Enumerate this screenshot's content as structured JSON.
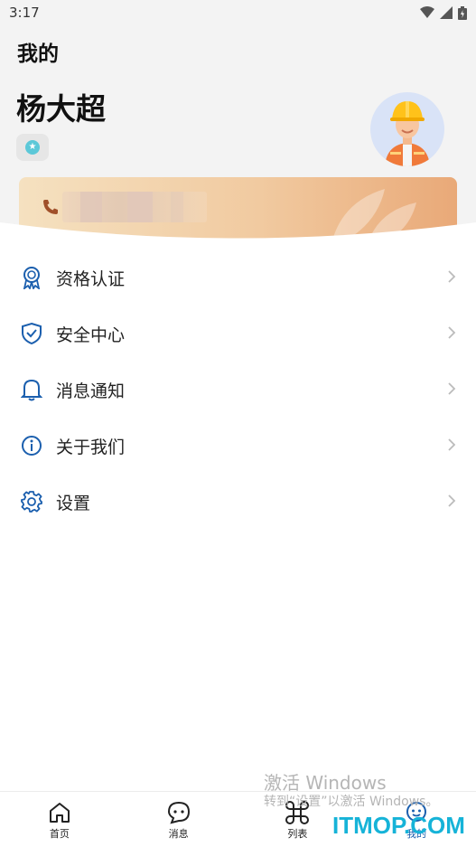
{
  "status_bar": {
    "time": "3:17"
  },
  "header": {
    "title": "我的"
  },
  "profile": {
    "name": "杨大超",
    "badge_icon": "star-badge-icon",
    "phone_icon": "phone-icon"
  },
  "menu": {
    "items": [
      {
        "label": "资格认证",
        "icon": "certificate-icon"
      },
      {
        "label": "安全中心",
        "icon": "shield-icon"
      },
      {
        "label": "消息通知",
        "icon": "bell-icon"
      },
      {
        "label": "关于我们",
        "icon": "info-icon"
      },
      {
        "label": "设置",
        "icon": "gear-icon"
      }
    ]
  },
  "watermark": {
    "line1": "激活 Windows",
    "line2": "转到“设置”以激活 Windows。"
  },
  "tabs": [
    {
      "label": "首页",
      "icon": "home-icon",
      "active": false
    },
    {
      "label": "消息",
      "icon": "chat-icon",
      "active": false
    },
    {
      "label": "列表",
      "icon": "command-icon",
      "active": false
    },
    {
      "label": "我的",
      "icon": "profile-icon",
      "active": true
    }
  ],
  "site_logo": "ITMOP.COM",
  "colors": {
    "accent": "#1b5fae",
    "card_gradient_start": "#f5e1c0",
    "card_gradient_end": "#e9a978",
    "logo": "#16b3d8"
  }
}
